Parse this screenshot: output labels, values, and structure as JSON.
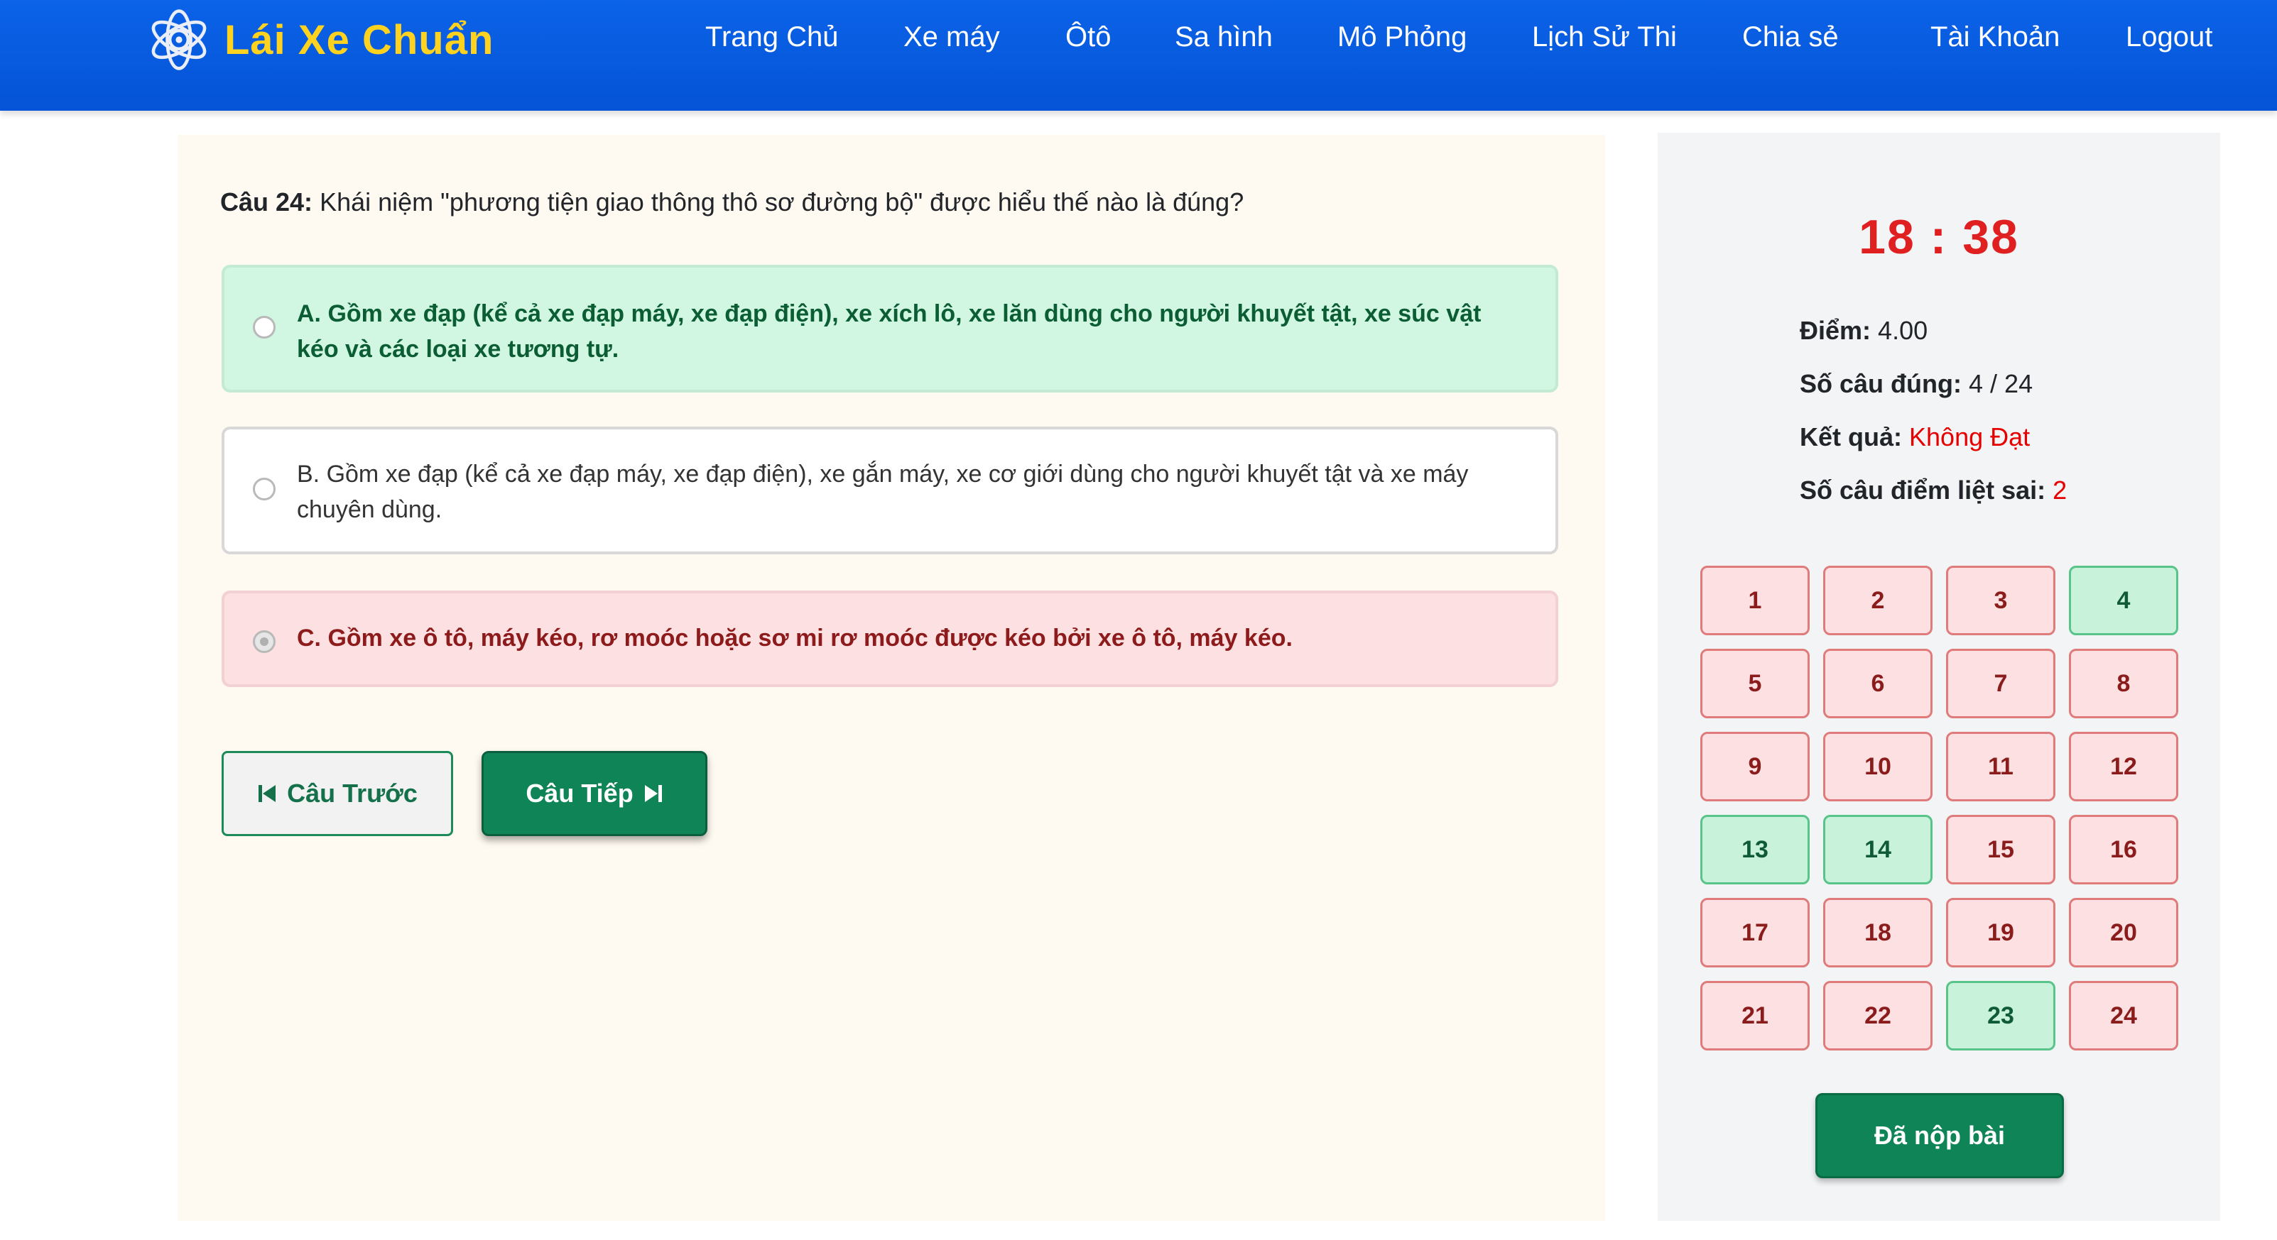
{
  "brand": {
    "name": "Lái Xe Chuẩn",
    "icon": "atom-wheel-logo-icon"
  },
  "nav": {
    "items": [
      "Trang Chủ",
      "Xe máy",
      "Ôtô",
      "Sa hình",
      "Mô Phỏng",
      "Lịch Sử Thi",
      "Chia sẻ",
      "Tài Khoản",
      "Logout"
    ]
  },
  "question": {
    "number_label": "Câu 24:",
    "text": "Khái niệm \"phương tiện giao thông thô sơ đường bộ\" được hiểu thế nào là đúng?"
  },
  "options": [
    {
      "text": "A. Gồm xe đạp (kể cả xe đạp máy, xe đạp điện), xe xích lô, xe lăn dùng cho người khuyết tật, xe súc vật kéo và các loại xe tương tự.",
      "state": "correct"
    },
    {
      "text": "B. Gồm xe đạp (kể cả xe đạp máy, xe đạp điện), xe gắn máy, xe cơ giới dùng cho người khuyết tật và xe máy chuyên dùng.",
      "state": "neutral"
    },
    {
      "text": "C. Gồm xe ô tô, máy kéo, rơ moóc hoặc sơ mi rơ moóc được kéo bởi xe ô tô, máy kéo.",
      "state": "wrong-selected"
    }
  ],
  "buttons": {
    "prev": "Câu Trước",
    "next": "Câu Tiếp",
    "submitted": "Đã nộp bài"
  },
  "sidebar": {
    "timer": "18 : 38",
    "score_label": "Điểm:",
    "score_value": "4.00",
    "correct_label": "Số câu đúng:",
    "correct_value": "4 / 24",
    "result_label": "Kết quả:",
    "result_value": "Không Đạt",
    "critical_label": "Số câu điểm liệt sai:",
    "critical_value": "2"
  },
  "question_grid": [
    {
      "n": "1",
      "s": "wrong"
    },
    {
      "n": "2",
      "s": "wrong"
    },
    {
      "n": "3",
      "s": "wrong"
    },
    {
      "n": "4",
      "s": "correct"
    },
    {
      "n": "5",
      "s": "wrong"
    },
    {
      "n": "6",
      "s": "wrong"
    },
    {
      "n": "7",
      "s": "wrong"
    },
    {
      "n": "8",
      "s": "wrong"
    },
    {
      "n": "9",
      "s": "wrong"
    },
    {
      "n": "10",
      "s": "wrong"
    },
    {
      "n": "11",
      "s": "wrong"
    },
    {
      "n": "12",
      "s": "wrong"
    },
    {
      "n": "13",
      "s": "correct"
    },
    {
      "n": "14",
      "s": "correct"
    },
    {
      "n": "15",
      "s": "wrong"
    },
    {
      "n": "16",
      "s": "wrong"
    },
    {
      "n": "17",
      "s": "wrong"
    },
    {
      "n": "18",
      "s": "wrong"
    },
    {
      "n": "19",
      "s": "wrong"
    },
    {
      "n": "20",
      "s": "wrong"
    },
    {
      "n": "21",
      "s": "wrong"
    },
    {
      "n": "22",
      "s": "wrong"
    },
    {
      "n": "23",
      "s": "correct"
    },
    {
      "n": "24",
      "s": "wrong"
    }
  ],
  "colors": {
    "navbar": "#0553d6",
    "brand": "#ffd21f",
    "correct_bg": "#d1f6e2",
    "wrong_bg": "#fde0e2",
    "primary_button": "#0f8456",
    "timer": "#e02020"
  }
}
